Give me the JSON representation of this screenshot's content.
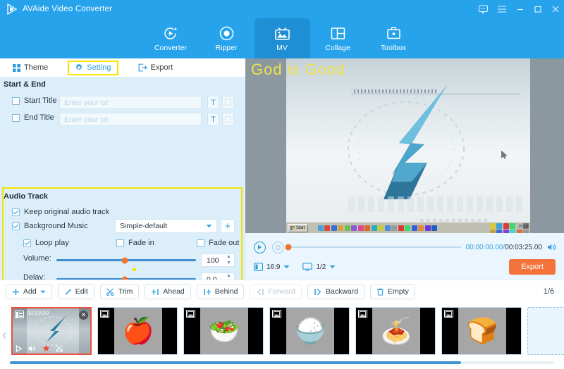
{
  "app": {
    "title": "AVAide Video Converter",
    "logo_icon": "play-triangle-icon"
  },
  "window_controls": [
    {
      "name": "feedback-icon",
      "glyph": "comment"
    },
    {
      "name": "menu-icon",
      "glyph": "hamburger"
    },
    {
      "name": "minimize-icon",
      "glyph": "minimize"
    },
    {
      "name": "maximize-icon",
      "glyph": "maximize"
    },
    {
      "name": "close-icon",
      "glyph": "close"
    }
  ],
  "nav_tabs": [
    {
      "label": "Converter",
      "icon": "convert-circular-arrow-icon",
      "active": false
    },
    {
      "label": "Ripper",
      "icon": "disc-icon",
      "active": false
    },
    {
      "label": "MV",
      "icon": "tv-image-icon",
      "active": true
    },
    {
      "label": "Collage",
      "icon": "grid-layout-icon",
      "active": false
    },
    {
      "label": "Toolbox",
      "icon": "toolbox-icon",
      "active": false
    }
  ],
  "sub_tabs": [
    {
      "label": "Theme",
      "icon": "four-squares-icon",
      "active": false,
      "highlighted": false
    },
    {
      "label": "Setting",
      "icon": "gear-icon",
      "active": true,
      "highlighted": true
    },
    {
      "label": "Export",
      "icon": "export-arrow-icon",
      "active": false,
      "highlighted": false
    }
  ],
  "start_end": {
    "section_label": "Start & End",
    "rows": [
      {
        "label": "Start Title",
        "checked": false,
        "placeholder": "Enter your txt",
        "value": "",
        "text_button": "T",
        "style_button": "frame-icon"
      },
      {
        "label": "End Title",
        "checked": false,
        "placeholder": "Enter your txt",
        "value": "",
        "text_button": "T",
        "style_button": "frame-icon"
      }
    ]
  },
  "audio_track": {
    "section_label": "Audio Track",
    "keep_original": {
      "label": "Keep original audio track",
      "checked": true
    },
    "background_music": {
      "label": "Background Music",
      "checked": true,
      "selected": "Simple-default",
      "add_button": "+"
    },
    "options": [
      {
        "label": "Loop play",
        "checked": true
      },
      {
        "label": "Fade in",
        "checked": false
      },
      {
        "label": "Fade out",
        "checked": false
      }
    ],
    "volume": {
      "label": "Volume:",
      "value": "100",
      "slider_pct": 47
    },
    "delay": {
      "label": "Delay:",
      "value": "0.0",
      "slider_pct": 47
    }
  },
  "preview": {
    "overlay_title": "God is Good",
    "taskbar_start": "Start",
    "taskbar_clock": "15:10",
    "play_button": "play-icon",
    "stop_button": "stop-icon",
    "current_time": "00:00:00.00",
    "time_separator": "/",
    "total_time": "00:03:25.00",
    "volume_icon": "speaker-icon",
    "aspect_icon": "aspect-ratio-icon",
    "aspect_ratio": "16:9",
    "screen_icon": "monitor-icon",
    "split_value": "1/2",
    "export_label": "Export",
    "progress_pct": 0
  },
  "toolbar": {
    "buttons": [
      {
        "label": "Add",
        "icon": "plus-icon",
        "has_caret": true,
        "disabled": false
      },
      {
        "label": "Edit",
        "icon": "magic-wand-icon",
        "has_caret": false,
        "disabled": false
      },
      {
        "label": "Trim",
        "icon": "scissors-icon",
        "has_caret": false,
        "disabled": false
      },
      {
        "label": "Ahead",
        "icon": "insert-ahead-icon",
        "has_caret": false,
        "disabled": false
      },
      {
        "label": "Behind",
        "icon": "insert-behind-icon",
        "has_caret": false,
        "disabled": false
      },
      {
        "label": "Forward",
        "icon": "move-forward-icon",
        "has_caret": false,
        "disabled": true
      },
      {
        "label": "Backward",
        "icon": "move-backward-icon",
        "has_caret": false,
        "disabled": false
      },
      {
        "label": "Empty",
        "icon": "trash-icon",
        "has_caret": false,
        "disabled": false
      }
    ],
    "page_indicator": "1/6"
  },
  "thumbnails": {
    "prev_arrow": "chevron-left-icon",
    "next_arrow": "chevron-right-icon",
    "items": [
      {
        "type": "video",
        "duration": "00:03:00",
        "badge": "film-icon",
        "selected": true,
        "tools": [
          "play-icon",
          "speaker-icon",
          "effect-icon",
          "scissors-icon"
        ],
        "close": "close-icon"
      },
      {
        "type": "image",
        "badge": "image-icon",
        "glyph": "🍎",
        "selected": false
      },
      {
        "type": "image",
        "badge": "image-icon",
        "glyph": "🥗",
        "selected": false
      },
      {
        "type": "image",
        "badge": "image-icon",
        "glyph": "🍚",
        "selected": false
      },
      {
        "type": "image",
        "badge": "image-icon",
        "glyph": "🍝",
        "selected": false
      },
      {
        "type": "image",
        "badge": "image-icon",
        "glyph": "🍞",
        "selected": false
      },
      {
        "type": "add-slot",
        "badge": "",
        "glyph": "",
        "selected": false
      }
    ]
  },
  "colors": {
    "brand_blue": "#27a3ec",
    "active_tab_blue": "#1e8fd4",
    "panel_blue": "#ddeefb",
    "highlight_yellow": "#f4e400",
    "accent_orange": "#f2762e",
    "export_orange": "#f4733a",
    "selected_red": "#e8523f",
    "overlay_yellow": "#f0e24a"
  }
}
